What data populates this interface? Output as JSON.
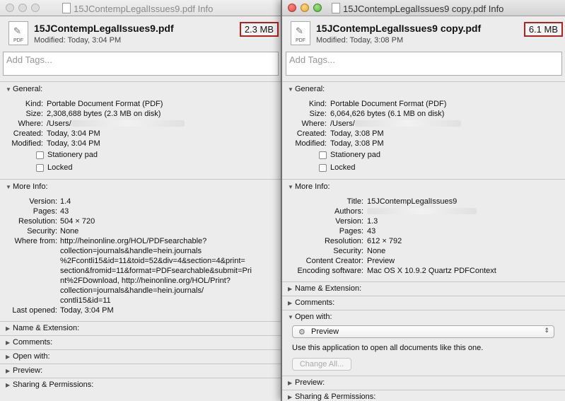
{
  "left": {
    "title": "15JContempLegalIssues9.pdf Info",
    "filename": "15JContempLegalIssues9.pdf",
    "modified": "Modified: Today, 3:04 PM",
    "size": "2.3 MB",
    "icon_label": "PDF",
    "tags_placeholder": "Add Tags...",
    "general": {
      "title": "General:",
      "kind_label": "Kind:",
      "kind": "Portable Document Format (PDF)",
      "size_label": "Size:",
      "size": "2,308,688 bytes (2.3 MB on disk)",
      "where_label": "Where:",
      "where": "/Users/",
      "created_label": "Created:",
      "created": "Today, 3:04 PM",
      "modified_label": "Modified:",
      "modified": "Today, 3:04 PM",
      "stationery": "Stationery pad",
      "locked": "Locked"
    },
    "more_info": {
      "title": "More Info:",
      "version_label": "Version:",
      "version": "1.4",
      "pages_label": "Pages:",
      "pages": "43",
      "resolution_label": "Resolution:",
      "resolution": "504 × 720",
      "security_label": "Security:",
      "security": "None",
      "where_from_label": "Where from:",
      "where_from_lines": [
        "http://heinonline.org/HOL/PDFsearchable?",
        "collection=journals&handle=hein.journals",
        "%2Fcontli15&id=11&toid=52&div=4&section=4&print=",
        "section&fromid=11&format=PDFsearchable&submit=Pri",
        "nt%2FDownload, http://heinonline.org/HOL/Print?",
        "collection=journals&handle=hein.journals/",
        "contli15&id=11"
      ],
      "last_opened_label": "Last opened:",
      "last_opened": "Today, 3:04 PM"
    },
    "collapsed": [
      "Name & Extension:",
      "Comments:",
      "Open with:",
      "Preview:",
      "Sharing & Permissions:"
    ]
  },
  "right": {
    "title": "15JContempLegalIssues9 copy.pdf Info",
    "filename": "15JContempLegalIssues9 copy.pdf",
    "modified": "Modified: Today, 3:08 PM",
    "size": "6.1 MB",
    "icon_label": "PDF",
    "tags_placeholder": "Add Tags...",
    "general": {
      "title": "General:",
      "kind_label": "Kind:",
      "kind": "Portable Document Format (PDF)",
      "size_label": "Size:",
      "size": "6,064,626 bytes (6.1 MB on disk)",
      "where_label": "Where:",
      "where": "/Users/",
      "created_label": "Created:",
      "created": "Today, 3:08 PM",
      "modified_label": "Modified:",
      "modified": "Today, 3:08 PM",
      "stationery": "Stationery pad",
      "locked": "Locked"
    },
    "more_info": {
      "title": "More Info:",
      "title_label": "Title:",
      "doc_title": "15JContempLegalIssues9",
      "authors_label": "Authors:",
      "version_label": "Version:",
      "version": "1.3",
      "pages_label": "Pages:",
      "pages": "43",
      "resolution_label": "Resolution:",
      "resolution": "612 × 792",
      "security_label": "Security:",
      "security": "None",
      "creator_label": "Content Creator:",
      "creator": "Preview",
      "encoding_label": "Encoding software:",
      "encoding": "Mac OS X 10.9.2 Quartz PDFContext"
    },
    "name_ext": "Name & Extension:",
    "comments": "Comments:",
    "open_with": {
      "title": "Open with:",
      "app": "Preview",
      "note": "Use this application to open all documents like this one.",
      "change_all": "Change All..."
    },
    "preview": "Preview:",
    "sharing": "Sharing & Permissions:"
  }
}
